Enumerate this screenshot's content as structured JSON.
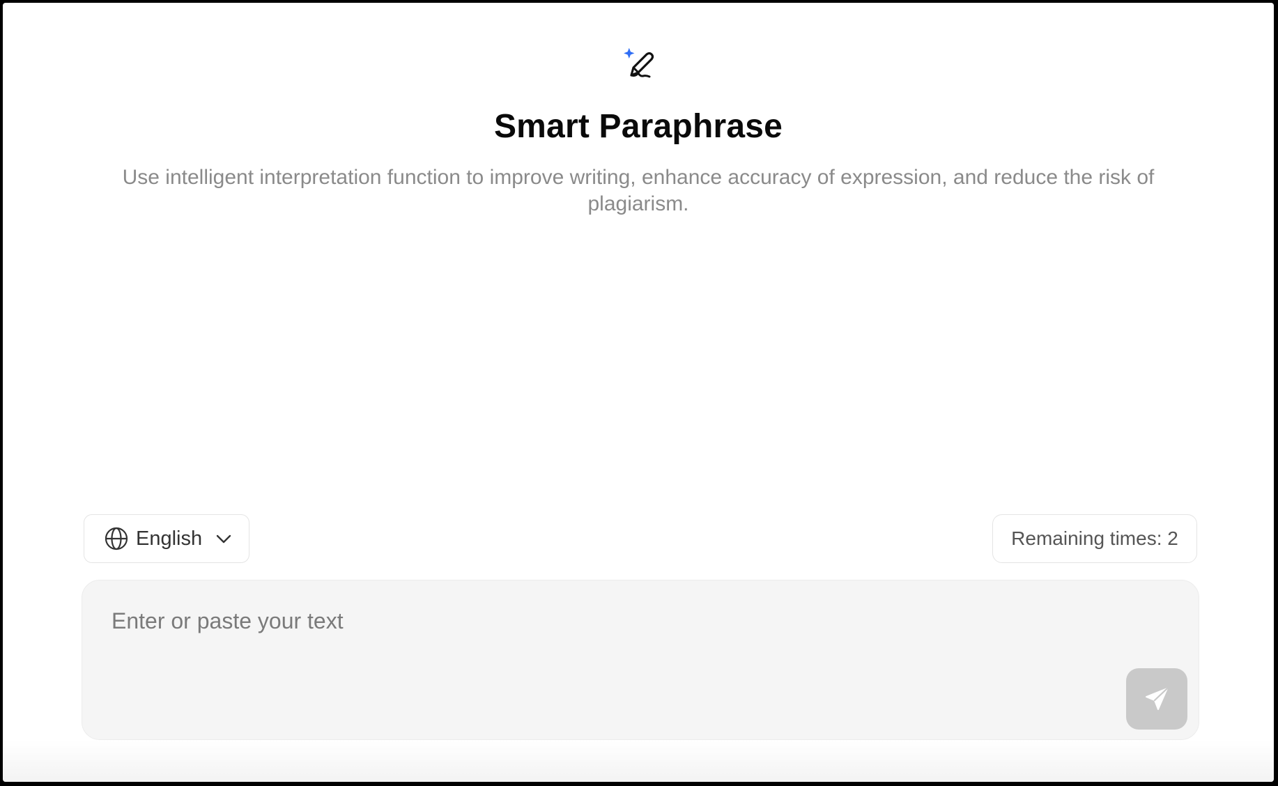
{
  "hero": {
    "icon": "sparkle-pen-signature-icon",
    "title": "Smart Paraphrase",
    "subtitle": "Use intelligent interpretation function to improve writing, enhance accuracy of expression, and reduce the risk of plagiarism."
  },
  "toolbar": {
    "language": {
      "icon": "globe-icon",
      "selected": "English",
      "dropdown_icon": "chevron-down-icon"
    },
    "remaining_label": "Remaining times: 2"
  },
  "composer": {
    "value": "",
    "placeholder": "Enter or paste your text",
    "send_icon": "paper-plane-icon"
  },
  "colors": {
    "sparkle_accent": "#2f6ef5",
    "send_button_disabled": "#c9c9c9",
    "composer_bg": "#f5f5f5"
  }
}
